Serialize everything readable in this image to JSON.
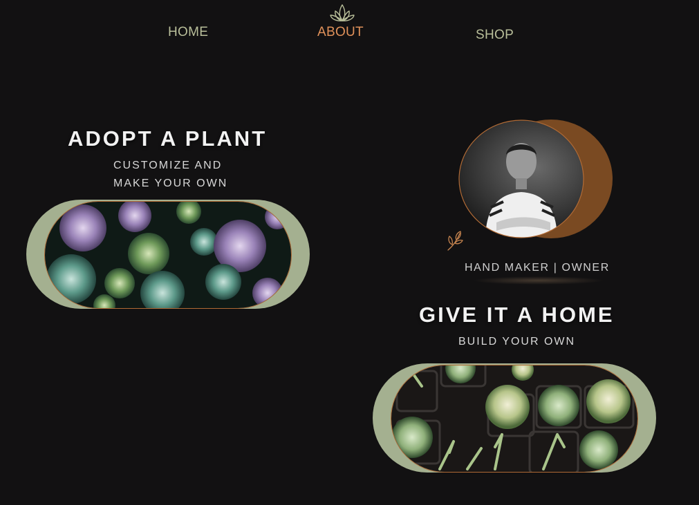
{
  "nav": {
    "home": "HOME",
    "about": "ABOUT",
    "shop": "SHOP",
    "logo_icon": "lotus-icon"
  },
  "adopt": {
    "title": "ADOPT A PLANT",
    "subtitle_line1": "CUSTOMIZE AND",
    "subtitle_line2": "MAKE YOUR OWN",
    "image": "succulents-photo"
  },
  "profile": {
    "caption": "HAND MAKER | OWNER",
    "image": "owner-portrait",
    "icon": "leaf-sprig-icon"
  },
  "home": {
    "title": "GIVE IT A HOME",
    "subtitle": "BUILD YOUR OWN",
    "image": "cacti-photo"
  },
  "colors": {
    "background": "#121112",
    "nav_text": "#b9bf9a",
    "accent": "#e0915a",
    "pill_frame": "#a4b090",
    "portrait_backdrop": "#7a4a22"
  }
}
